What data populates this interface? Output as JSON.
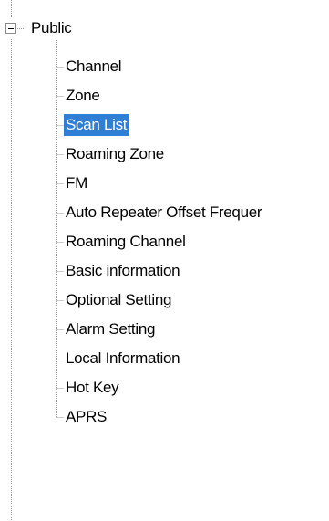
{
  "tree": {
    "root": {
      "label": "Public",
      "expanded": true
    },
    "selected_index": 2,
    "children": [
      {
        "label": "Channel"
      },
      {
        "label": "Zone"
      },
      {
        "label": "Scan List"
      },
      {
        "label": "Roaming Zone"
      },
      {
        "label": "FM"
      },
      {
        "label": "Auto Repeater Offset Frequer"
      },
      {
        "label": "Roaming Channel"
      },
      {
        "label": "Basic information"
      },
      {
        "label": "Optional Setting"
      },
      {
        "label": "Alarm Setting"
      },
      {
        "label": "Local Information"
      },
      {
        "label": "Hot Key"
      },
      {
        "label": "APRS"
      }
    ]
  },
  "colors": {
    "selection_bg": "#2f7fd6",
    "selection_text": "#ffffff",
    "tree_line": "#9a9a9a"
  },
  "icons": {
    "expander": "minus-box-icon"
  }
}
